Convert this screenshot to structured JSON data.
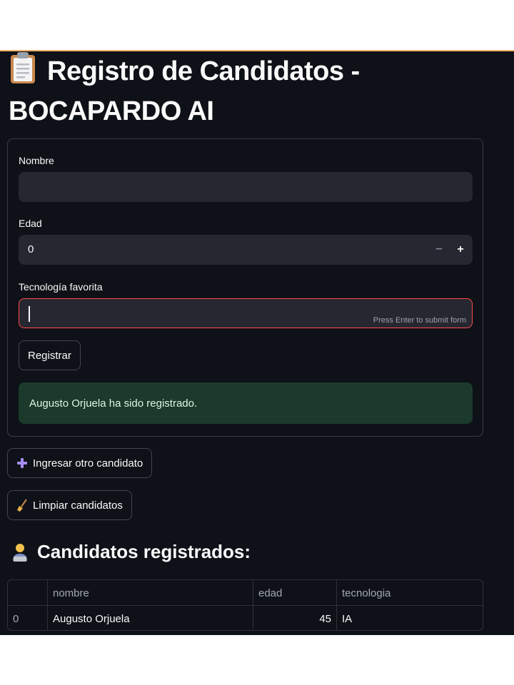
{
  "title": "Registro de Candidatos - BOCAPARDO AI",
  "title_icon": "clipboard-icon",
  "form": {
    "nombre_label": "Nombre",
    "nombre_value": "",
    "edad_label": "Edad",
    "edad_value": "0",
    "minus_label": "−",
    "plus_label": "+",
    "tecnologia_label": "Tecnología favorita",
    "tecnologia_value": "",
    "tecnologia_hint": "Press Enter to submit form",
    "submit_label": "Registrar",
    "success_message": "Augusto Orjuela ha sido registrado."
  },
  "actions": {
    "add_label": "Ingresar otro candidato",
    "add_icon": "plus-icon",
    "clear_label": "Limpiar candidatos",
    "clear_icon": "broom-icon"
  },
  "section": {
    "title": "Candidatos registrados:",
    "icon": "person-at-laptop-icon"
  },
  "table": {
    "columns": [
      "",
      "nombre",
      "edad",
      "tecnologia"
    ],
    "rows": [
      {
        "index": "0",
        "nombre": "Augusto Orjuela",
        "edad": "45",
        "tecnologia": "IA"
      }
    ]
  },
  "colors": {
    "background": "#0e1117",
    "accent": "#f0b36a",
    "error_border": "#ff4b4b",
    "success_bg": "#1b3a2b"
  }
}
